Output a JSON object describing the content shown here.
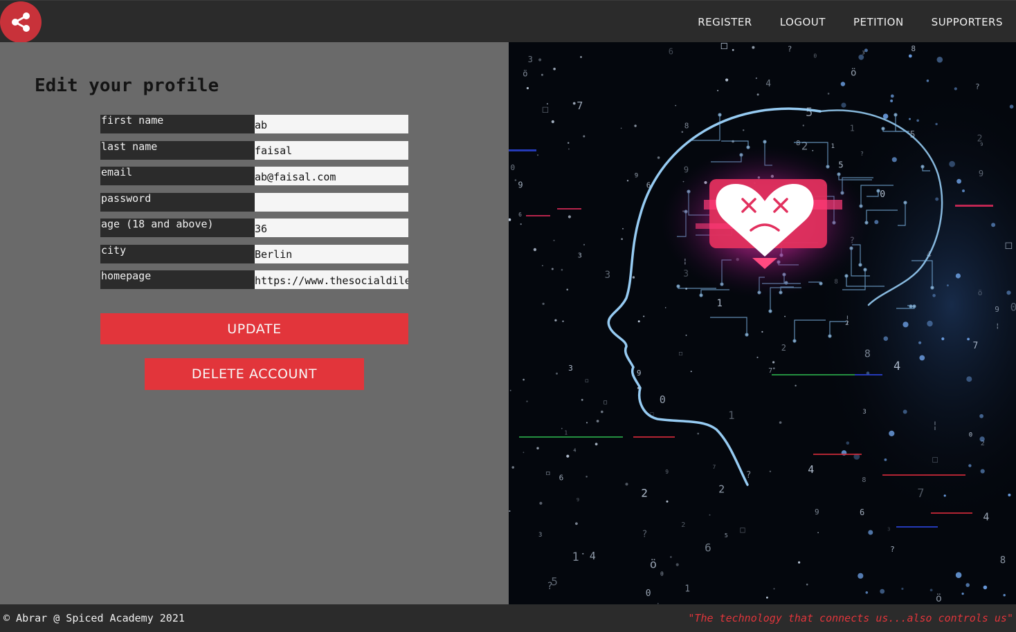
{
  "header": {
    "logo_icon": "share-icon",
    "nav": [
      {
        "label": "REGISTER"
      },
      {
        "label": "LOGOUT"
      },
      {
        "label": "PETITION"
      },
      {
        "label": "SUPPORTERS"
      }
    ]
  },
  "main": {
    "title": "Edit your profile",
    "fields": [
      {
        "label": "first name",
        "value": "ab"
      },
      {
        "label": "last name",
        "value": "faisal"
      },
      {
        "label": "email",
        "value": "ab@faisal.com"
      },
      {
        "label": "password",
        "value": ""
      },
      {
        "label": "age (18 and above)",
        "value": "36"
      },
      {
        "label": "city",
        "value": "Berlin"
      },
      {
        "label": "homepage",
        "value": "https://www.thesocialdilemma.com"
      }
    ],
    "update_label": "UPDATE",
    "delete_label": "DELETE ACCOUNT"
  },
  "hero_image": {
    "icon": "ai-head-broken-heart-image"
  },
  "footer": {
    "copyright": "© Abrar @ Spiced Academy 2021",
    "quote": "\"The technology that connects us...also controls us\""
  },
  "colors": {
    "header_bg": "#2b2b2b",
    "page_bg": "#6a6a6a",
    "accent": "#e2353b",
    "input_bg": "#f5f5f5"
  }
}
